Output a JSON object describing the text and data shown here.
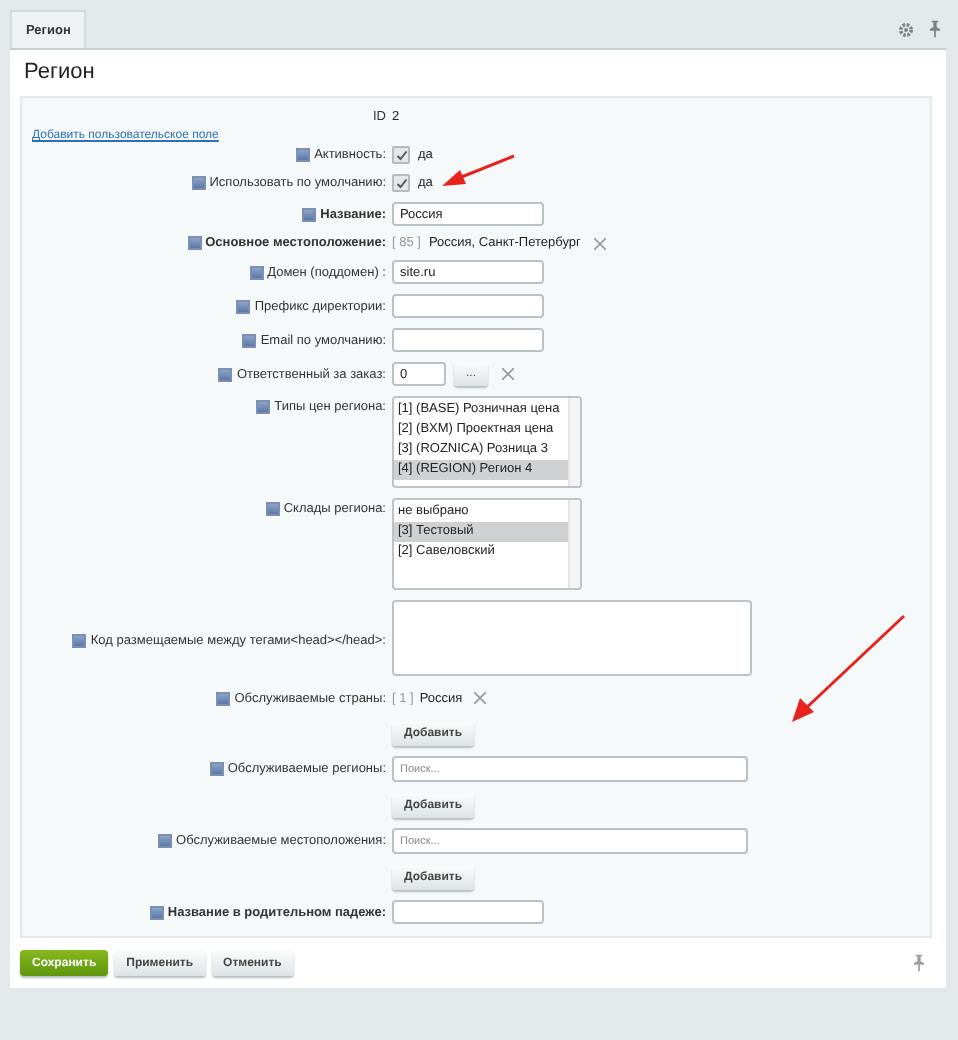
{
  "tabs": [
    {
      "label": "Регион",
      "selected": true
    }
  ],
  "title": "Регион",
  "fields": [
    {
      "kind": "static",
      "label": "ID",
      "value": "2"
    },
    {
      "kind": "link",
      "text": "Добавить пользовательское поле"
    },
    {
      "kind": "checkbox",
      "label": "Активность:",
      "checked": true,
      "option": "да"
    },
    {
      "kind": "checkbox",
      "label": "Использовать по умолчанию:",
      "checked": true,
      "option": "да"
    },
    {
      "kind": "text",
      "label": "Название:",
      "value": "Россия",
      "bold": true
    },
    {
      "kind": "location",
      "label": "Основное местоположение:",
      "code": "[ 85 ]",
      "value": "Россия, Санкт-Петербург",
      "bold": true
    },
    {
      "kind": "text",
      "label": "Домен (поддомен) :",
      "value": "site.ru"
    },
    {
      "kind": "text",
      "label": "Префикс директории:"
    },
    {
      "kind": "text",
      "label": "Email по умолчанию:"
    },
    {
      "kind": "user",
      "label": "Ответственный за заказ:",
      "value": "0",
      "button": "..."
    },
    {
      "kind": "listbox",
      "label": "Типы цен региона:",
      "scrolled": true,
      "options": [
        {
          "text": "[1] (BASE) Розничная цена",
          "selected": false
        },
        {
          "text": "[2] (BXM) Проектная цена",
          "selected": false
        },
        {
          "text": "[3] (ROZNICA) Розница 3",
          "selected": false
        },
        {
          "text": "[4] (REGION) Регион 4",
          "selected": true
        }
      ]
    },
    {
      "kind": "listbox",
      "label": "Склады региона:",
      "options": [
        {
          "text": "не выбрано",
          "selected": false
        },
        {
          "text": "[3] Тестовый",
          "selected": true
        },
        {
          "text": "[2] Савеловский",
          "selected": false
        }
      ]
    },
    {
      "kind": "textarea",
      "label": "Код размещаемые между тегами<head></head>:"
    },
    {
      "kind": "tags",
      "label": "Обслуживаемые страны:",
      "tags": [
        {
          "code": "[ 1 ]",
          "text": "Россия"
        }
      ],
      "button": "Добавить"
    },
    {
      "kind": "search",
      "label": "Обслуживаемые регионы:",
      "placeholder": "Поиск...",
      "button": "Добавить"
    },
    {
      "kind": "search",
      "label": "Обслуживаемые местоположения:",
      "placeholder": "Поиск...",
      "button": "Добавить"
    },
    {
      "kind": "text",
      "label": "Название в родительном падеже:",
      "bold": true
    }
  ],
  "buttons": [
    {
      "label": "Сохранить",
      "kind": "primary"
    },
    {
      "label": "Применить",
      "kind": "normal"
    },
    {
      "label": "Отменить",
      "kind": "normal"
    }
  ]
}
